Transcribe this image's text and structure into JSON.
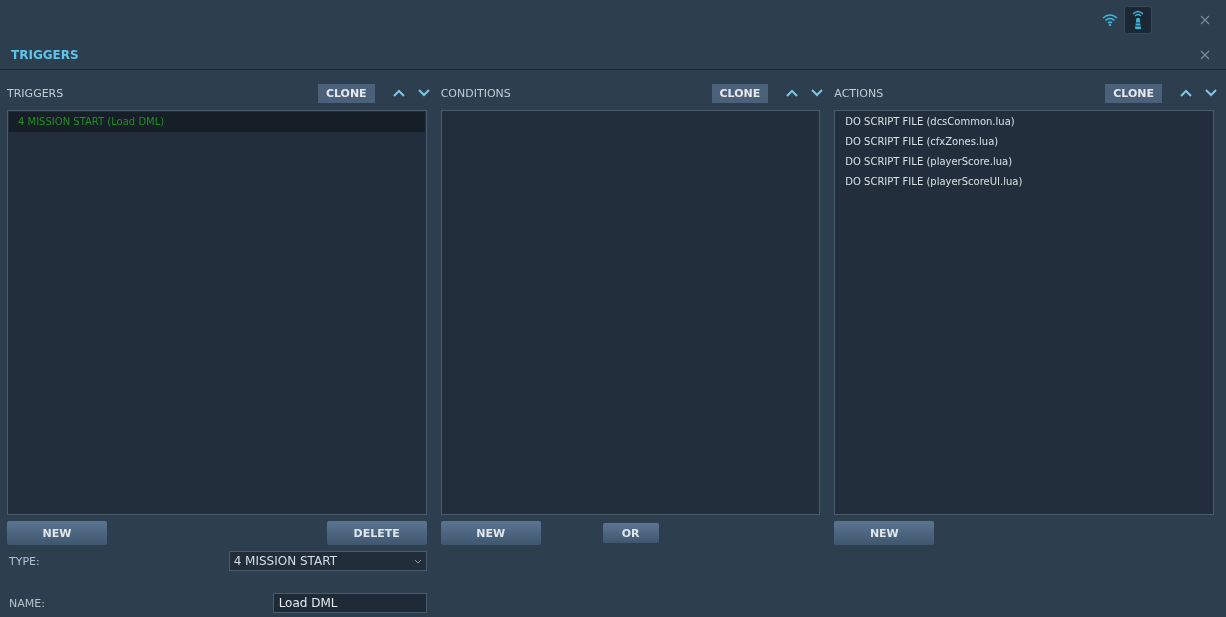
{
  "window": {
    "title": "TRIGGERS"
  },
  "triggers": {
    "heading": "TRIGGERS",
    "clone_label": "CLONE",
    "items": [
      {
        "label": "4 MISSION START (Load DML)",
        "selected": true
      }
    ],
    "buttons": [
      "NEW",
      "DELETE"
    ]
  },
  "conditions": {
    "heading": "CONDITIONS",
    "clone_label": "CLONE",
    "buttons": [
      "NEW",
      "OR"
    ]
  },
  "actions": {
    "heading": "ACTIONS",
    "clone_label": "CLONE",
    "items": [
      {
        "label": "DO SCRIPT FILE (dcsCommon.lua)",
        "selected": false
      },
      {
        "label": "DO SCRIPT FILE (cfxZones.lua)",
        "selected": false
      },
      {
        "label": "DO SCRIPT FILE (playerScore.lua)",
        "selected": false
      },
      {
        "label": "DO SCRIPT FILE (playerScoreUI.lua)",
        "selected": false
      }
    ],
    "buttons": [
      "NEW"
    ]
  },
  "type": {
    "label": "TYPE:",
    "value": "4 MISSION START"
  },
  "name": {
    "label": "NAME:",
    "value": "Load DML"
  }
}
